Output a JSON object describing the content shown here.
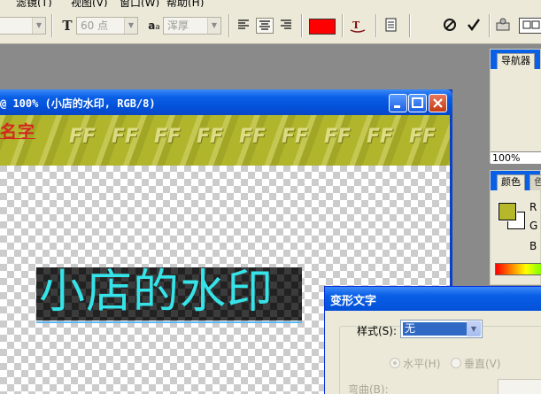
{
  "menu": {
    "items": [
      "滤镜(T)",
      "视图(V)",
      "窗口(W)",
      "帮助(H)"
    ]
  },
  "optionsbar": {
    "font_size": "60 点",
    "aa_label": "a",
    "aa_small": "a",
    "antialias_value": "浑厚",
    "text_color": "#ff0000",
    "icon_font_size": "T"
  },
  "document": {
    "title": "@ 100% (小店的水印, RGB/8)",
    "banner_text": "名字",
    "banner_pattern": [
      "FF",
      "FF",
      "FF",
      "FF",
      "FF",
      "FF",
      "FF",
      "FF",
      "FF",
      "FF"
    ],
    "watermark_text": "小店的水印",
    "watermark_color": "#35e3e8"
  },
  "panels": {
    "navigator": {
      "tab": "导航器",
      "zoom": "100%"
    },
    "color": {
      "tab_active": "颜色",
      "tab_next": "色",
      "fg_color": "#b5b82a",
      "channel_r": "R",
      "channel_g": "G",
      "channel_b": "B"
    }
  },
  "dialog": {
    "title": "变形文字",
    "style_label": "样式(S):",
    "style_value": "无",
    "horizontal_label": "水平(H)",
    "vertical_label": "垂直(V)",
    "bend_label": "弯曲(B):"
  }
}
